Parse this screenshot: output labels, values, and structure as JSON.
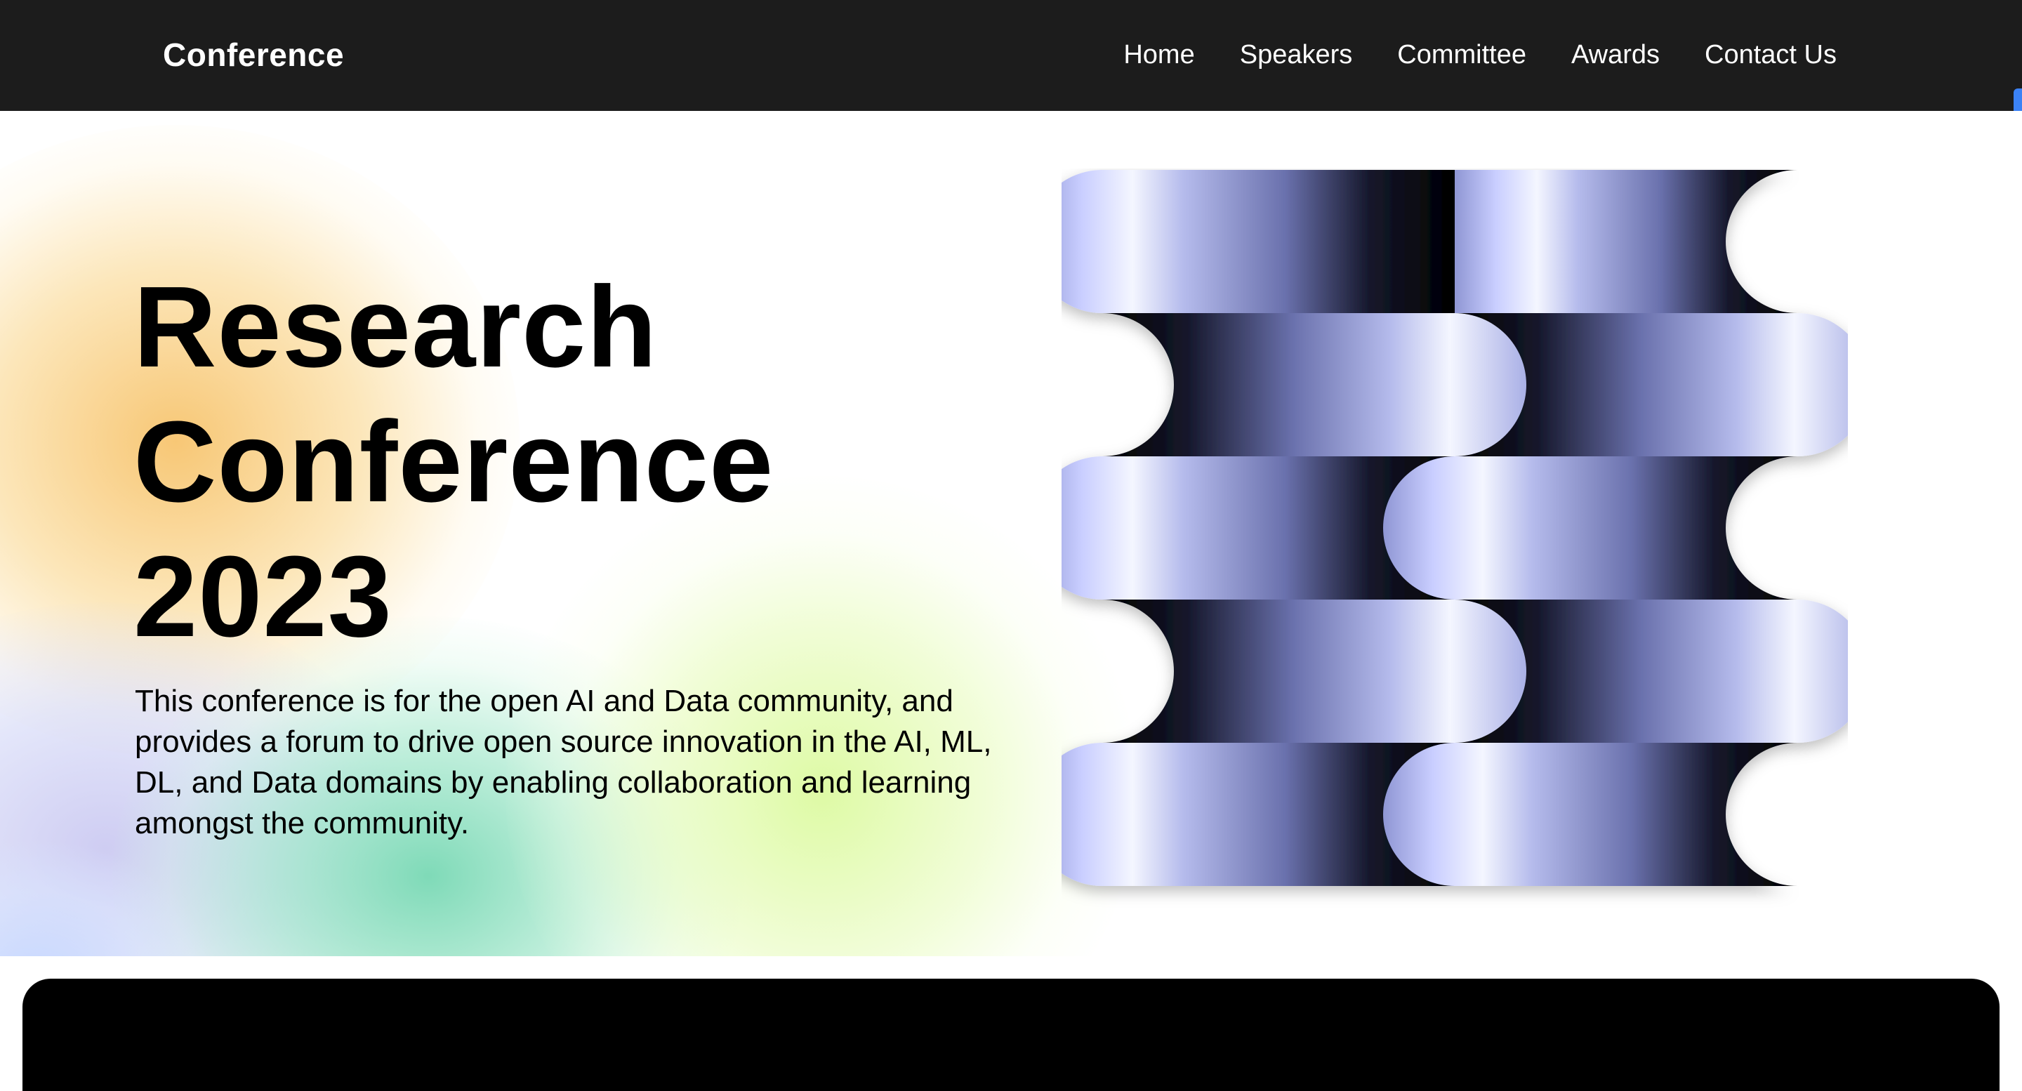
{
  "navbar": {
    "brand": "Conference",
    "links": [
      {
        "label": "Home"
      },
      {
        "label": "Speakers"
      },
      {
        "label": "Committee"
      },
      {
        "label": "Awards"
      },
      {
        "label": "Contact Us"
      }
    ],
    "background_color": "#1c1c1c",
    "scroll_indicator_color": "#3b82f6"
  },
  "hero": {
    "title_lines": [
      "Research",
      "Conference",
      "2023"
    ],
    "description": "This conference is for the open AI and Data community, and provides a forum to drive open source innovation in the AI, ML, DL, and Data domains by enabling collaboration and learning amongst the community.",
    "artwork": {
      "icon": "woven-ribbon-artwork",
      "colors": {
        "highlight": "#f2f4ff",
        "mid": "#a9b0e6",
        "shadow": "#000000"
      }
    }
  },
  "bottom_panel": {
    "color": "#000000"
  }
}
